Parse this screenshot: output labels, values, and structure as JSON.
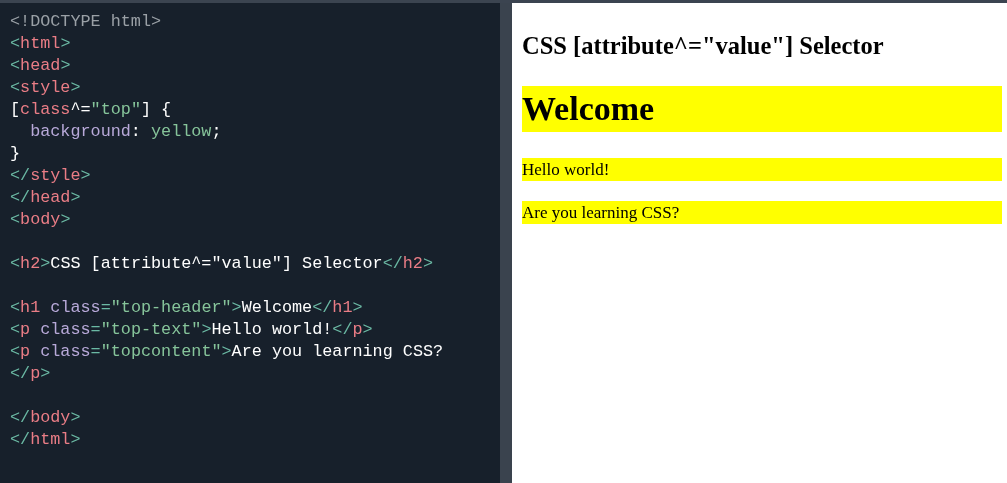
{
  "editor": {
    "lines": [
      {
        "kind": "code",
        "tokens": [
          {
            "kind": "doctype",
            "text": "<!DOCTYPE html>"
          }
        ]
      },
      {
        "kind": "code",
        "tokens": [
          {
            "kind": "punct",
            "text": "<"
          },
          {
            "kind": "tag",
            "text": "html"
          },
          {
            "kind": "punct",
            "text": ">"
          }
        ]
      },
      {
        "kind": "code",
        "tokens": [
          {
            "kind": "punct",
            "text": "<"
          },
          {
            "kind": "tag",
            "text": "head"
          },
          {
            "kind": "punct",
            "text": ">"
          }
        ]
      },
      {
        "kind": "code",
        "tokens": [
          {
            "kind": "punct",
            "text": "<"
          },
          {
            "kind": "tag",
            "text": "style"
          },
          {
            "kind": "punct",
            "text": ">"
          }
        ]
      },
      {
        "kind": "code",
        "tokens": [
          {
            "kind": "text",
            "text": "["
          },
          {
            "kind": "tag",
            "text": "class"
          },
          {
            "kind": "text",
            "text": "^="
          },
          {
            "kind": "string",
            "text": "\"top\""
          },
          {
            "kind": "text",
            "text": "] {"
          }
        ]
      },
      {
        "kind": "code",
        "tokens": [
          {
            "kind": "attr",
            "text": "  background"
          },
          {
            "kind": "text",
            "text": ": "
          },
          {
            "kind": "string",
            "text": "yellow"
          },
          {
            "kind": "text",
            "text": ";"
          }
        ]
      },
      {
        "kind": "code",
        "tokens": [
          {
            "kind": "text",
            "text": "}"
          }
        ]
      },
      {
        "kind": "code",
        "tokens": [
          {
            "kind": "punct",
            "text": "</"
          },
          {
            "kind": "tag",
            "text": "style"
          },
          {
            "kind": "punct",
            "text": ">"
          }
        ]
      },
      {
        "kind": "code",
        "tokens": [
          {
            "kind": "punct",
            "text": "</"
          },
          {
            "kind": "tag",
            "text": "head"
          },
          {
            "kind": "punct",
            "text": ">"
          }
        ]
      },
      {
        "kind": "code",
        "tokens": [
          {
            "kind": "punct",
            "text": "<"
          },
          {
            "kind": "tag",
            "text": "body"
          },
          {
            "kind": "punct",
            "text": ">"
          }
        ]
      },
      {
        "kind": "blank"
      },
      {
        "kind": "code",
        "tokens": [
          {
            "kind": "punct",
            "text": "<"
          },
          {
            "kind": "tag",
            "text": "h2"
          },
          {
            "kind": "punct",
            "text": ">"
          },
          {
            "kind": "text",
            "text": "CSS [attribute^=\"value\"] Selector"
          },
          {
            "kind": "punct",
            "text": "</"
          },
          {
            "kind": "tag",
            "text": "h2"
          },
          {
            "kind": "punct",
            "text": ">"
          }
        ]
      },
      {
        "kind": "blank"
      },
      {
        "kind": "code",
        "tokens": [
          {
            "kind": "punct",
            "text": "<"
          },
          {
            "kind": "tag",
            "text": "h1"
          },
          {
            "kind": "attr",
            "text": " class"
          },
          {
            "kind": "punct",
            "text": "="
          },
          {
            "kind": "string",
            "text": "\"top-header\""
          },
          {
            "kind": "punct",
            "text": ">"
          },
          {
            "kind": "text",
            "text": "Welcome"
          },
          {
            "kind": "punct",
            "text": "</"
          },
          {
            "kind": "tag",
            "text": "h1"
          },
          {
            "kind": "punct",
            "text": ">"
          }
        ]
      },
      {
        "kind": "code",
        "tokens": [
          {
            "kind": "punct",
            "text": "<"
          },
          {
            "kind": "tag",
            "text": "p"
          },
          {
            "kind": "attr",
            "text": " class"
          },
          {
            "kind": "punct",
            "text": "="
          },
          {
            "kind": "string",
            "text": "\"top-text\""
          },
          {
            "kind": "punct",
            "text": ">"
          },
          {
            "kind": "text",
            "text": "Hello world!"
          },
          {
            "kind": "punct",
            "text": "</"
          },
          {
            "kind": "tag",
            "text": "p"
          },
          {
            "kind": "punct",
            "text": ">"
          }
        ]
      },
      {
        "kind": "code",
        "tokens": [
          {
            "kind": "punct",
            "text": "<"
          },
          {
            "kind": "tag",
            "text": "p"
          },
          {
            "kind": "attr",
            "text": " class"
          },
          {
            "kind": "punct",
            "text": "="
          },
          {
            "kind": "string",
            "text": "\"topcontent\""
          },
          {
            "kind": "punct",
            "text": ">"
          },
          {
            "kind": "text",
            "text": "Are you learning CSS?"
          }
        ]
      },
      {
        "kind": "code",
        "tokens": [
          {
            "kind": "punct",
            "text": "</"
          },
          {
            "kind": "tag",
            "text": "p"
          },
          {
            "kind": "punct",
            "text": ">"
          }
        ]
      },
      {
        "kind": "blank"
      },
      {
        "kind": "code",
        "tokens": [
          {
            "kind": "punct",
            "text": "</"
          },
          {
            "kind": "tag",
            "text": "body"
          },
          {
            "kind": "punct",
            "text": ">"
          }
        ]
      },
      {
        "kind": "code",
        "tokens": [
          {
            "kind": "punct",
            "text": "</"
          },
          {
            "kind": "tag",
            "text": "html"
          },
          {
            "kind": "punct",
            "text": ">"
          }
        ]
      }
    ]
  },
  "preview": {
    "blocks": [
      {
        "kind": "h2",
        "text": "CSS [attribute^=\"value\"] Selector",
        "highlighted": false
      },
      {
        "kind": "h1",
        "text": "Welcome",
        "highlighted": true
      },
      {
        "kind": "p",
        "text": "Hello world!",
        "highlighted": true
      },
      {
        "kind": "p",
        "text": "Are you learning CSS?",
        "highlighted": true
      }
    ]
  }
}
